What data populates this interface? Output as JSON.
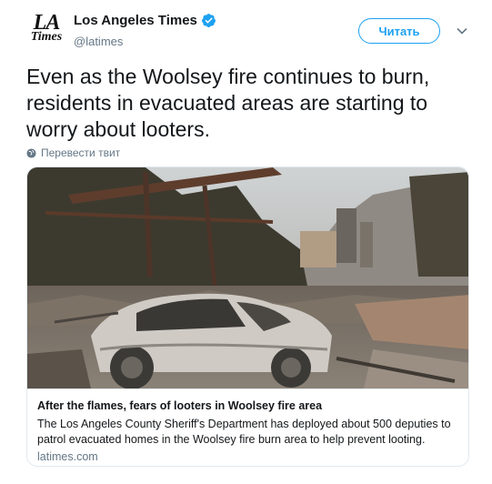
{
  "header": {
    "logo_line1": "LA",
    "logo_line2": "Times",
    "display_name": "Los Angeles Times",
    "handle": "@latimes",
    "follow_label": "Читать"
  },
  "tweet": {
    "text": "Even as the Woolsey fire continues to burn, residents in evacuated areas are starting to worry about looters.",
    "translate_label": "Перевести твит"
  },
  "card": {
    "title": "After the flames, fears of looters in Woolsey fire area",
    "description": "The Los Angeles County Sheriff's Department has deployed about 500 deputies to patrol evacuated homes in the Woolsey fire burn area to help prevent looting.",
    "domain": "latimes.com"
  },
  "colors": {
    "accent": "#1da1f2",
    "text": "#14171a",
    "secondary": "#657786",
    "border": "#e1e8ed"
  },
  "icons": {
    "verified": "verified-badge-icon",
    "caret": "chevron-down-icon",
    "translate": "globe-icon"
  }
}
